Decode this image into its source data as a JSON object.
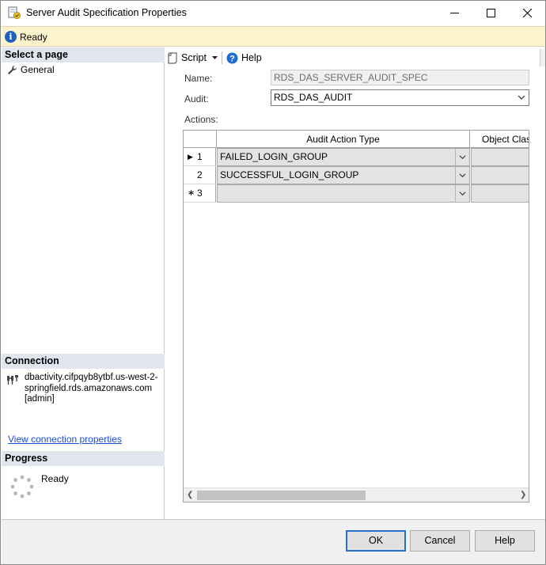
{
  "window": {
    "title": "Server Audit Specification Properties",
    "icons": {
      "app": "audit-spec-icon",
      "minimize": "minimize-icon",
      "maximize": "maximize-icon",
      "close": "close-icon"
    }
  },
  "status_bar": {
    "icon": "info-icon",
    "text": "Ready"
  },
  "left_pane": {
    "select_page": {
      "header": "Select a page",
      "items": [
        {
          "label": "General",
          "icon": "wrench-icon"
        }
      ]
    },
    "connection": {
      "header": "Connection",
      "icon": "connection-icon",
      "server": "dbactivity.cifpqyb8ytbf.us-west-2-springfield.rds.amazonaws.com",
      "user": "[admin]",
      "link": "View connection properties"
    },
    "progress": {
      "header": "Progress",
      "icon": "progress-spinner-icon",
      "status": "Ready"
    }
  },
  "toolbar": {
    "script_label": "Script",
    "help_label": "Help",
    "icons": {
      "script": "script-icon",
      "dropdown": "dropdown-arrow-icon",
      "help": "help-icon"
    }
  },
  "form": {
    "name_label": "Name:",
    "name_value": "RDS_DAS_SERVER_AUDIT_SPEC",
    "audit_label": "Audit:",
    "audit_value": "RDS_DAS_AUDIT",
    "actions_label": "Actions:"
  },
  "grid": {
    "columns": [
      "Audit Action Type",
      "Object Class"
    ],
    "rows": [
      {
        "marker": "▶",
        "num": "1",
        "action": "FAILED_LOGIN_GROUP"
      },
      {
        "marker": "",
        "num": "2",
        "action": "SUCCESSFUL_LOGIN_GROUP"
      },
      {
        "marker": "∗",
        "num": "3",
        "action": ""
      }
    ]
  },
  "buttons": {
    "ok": "OK",
    "cancel": "Cancel",
    "help": "Help"
  },
  "colors": {
    "ready_bar": "#fcf3cd",
    "section_header": "#e1e5ee",
    "link": "#1a4cd6",
    "primary_border": "#2b6fce"
  }
}
